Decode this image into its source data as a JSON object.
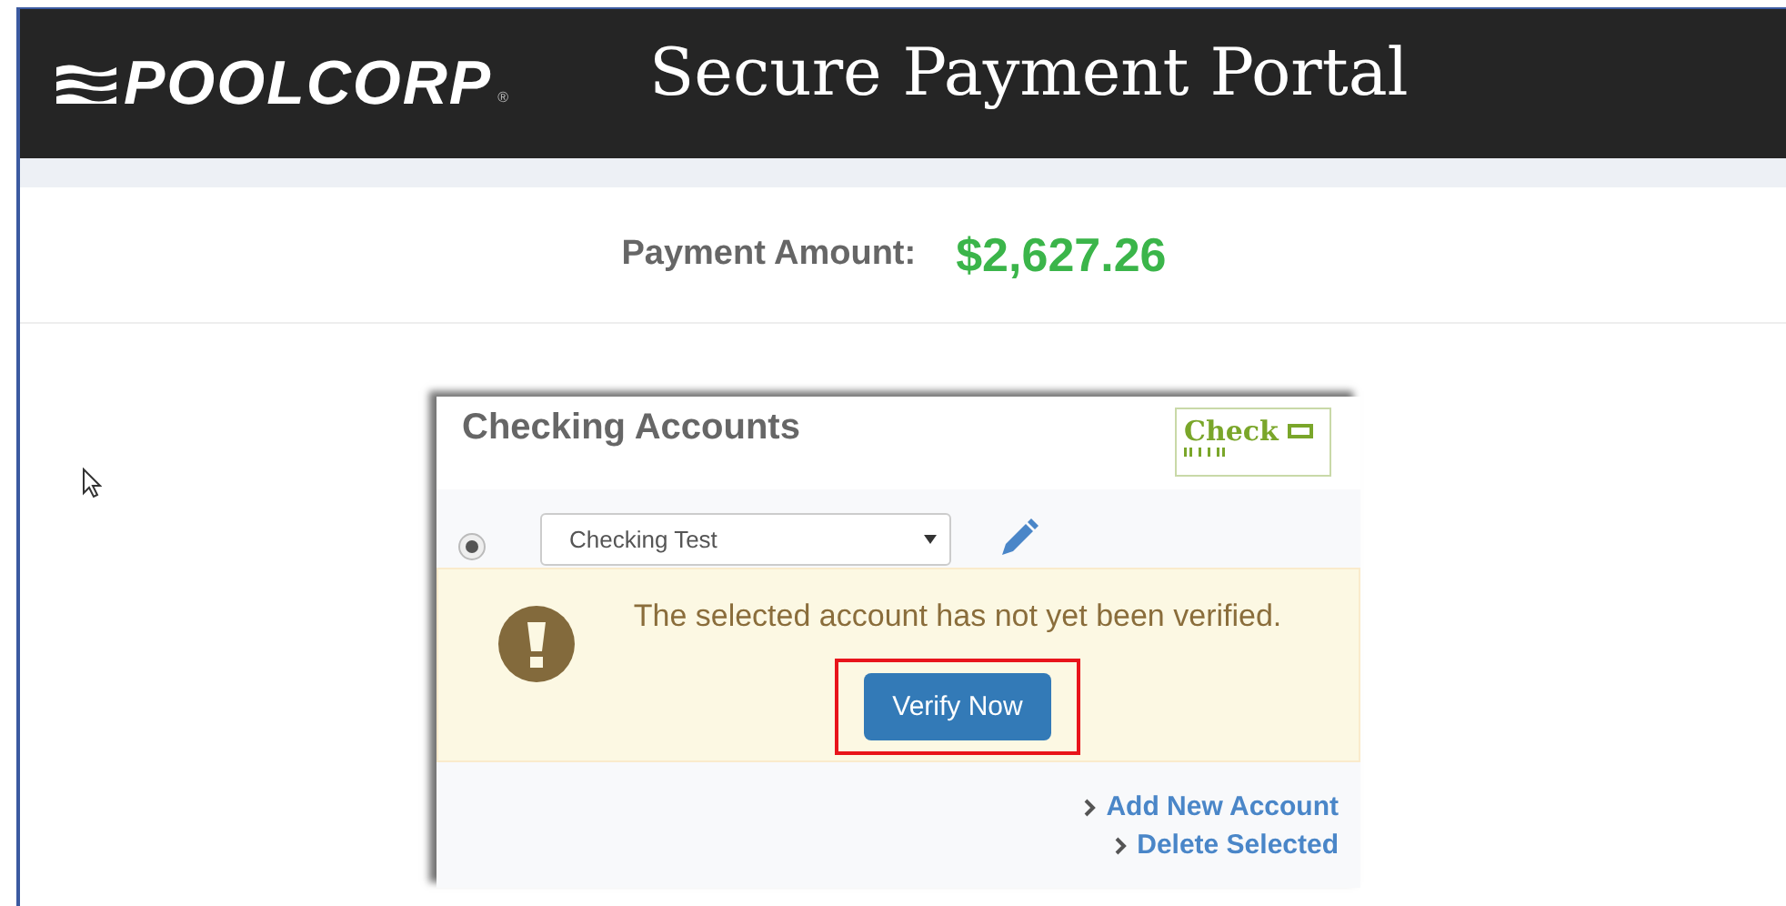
{
  "header": {
    "logo": "POOLCORP",
    "logo_mark": "®",
    "title": "Secure Payment Portal"
  },
  "payment": {
    "label": "Payment Amount:",
    "amount": "$2,627.26"
  },
  "accounts_card": {
    "title": "Checking Accounts",
    "badge": "Check",
    "accounts": [
      {
        "name": "Checking Test",
        "selected": true
      }
    ],
    "alert": {
      "message": "The selected account has not yet been verified.",
      "button": "Verify Now",
      "highlighted": true
    },
    "links": [
      "Add New Account",
      "Delete Selected"
    ]
  }
}
